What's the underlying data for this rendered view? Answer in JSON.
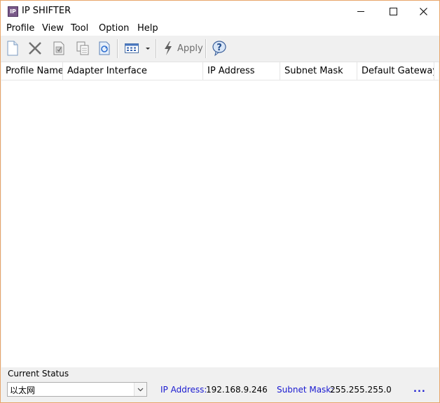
{
  "window": {
    "title": "IP SHIFTER",
    "icon_text": "IP"
  },
  "menu": [
    "Profile",
    "View",
    "Tool",
    "Option",
    "Help"
  ],
  "toolbar": {
    "apply_label": "Apply",
    "icons": [
      "new-profile-icon",
      "delete-icon",
      "edit-icon",
      "copy-icon",
      "refresh-icon",
      "view-icon",
      "dropdown-icon",
      "apply-icon",
      "help-icon"
    ]
  },
  "list": {
    "columns": [
      "Profile Name",
      "Adapter Interface",
      "IP Address",
      "Subnet Mask",
      "Default Gateway"
    ]
  },
  "status": {
    "label": "Current Status",
    "adapter": "以太网",
    "ip_label": "IP Address:",
    "ip_value": "192.168.9.246",
    "mask_label": "Subnet Mask:",
    "mask_value": "255.255.255.0",
    "more": "..."
  },
  "colors": {
    "window_border": "#e8a56a",
    "link_blue": "#1a1ad0",
    "face": "#f0f0f0"
  }
}
